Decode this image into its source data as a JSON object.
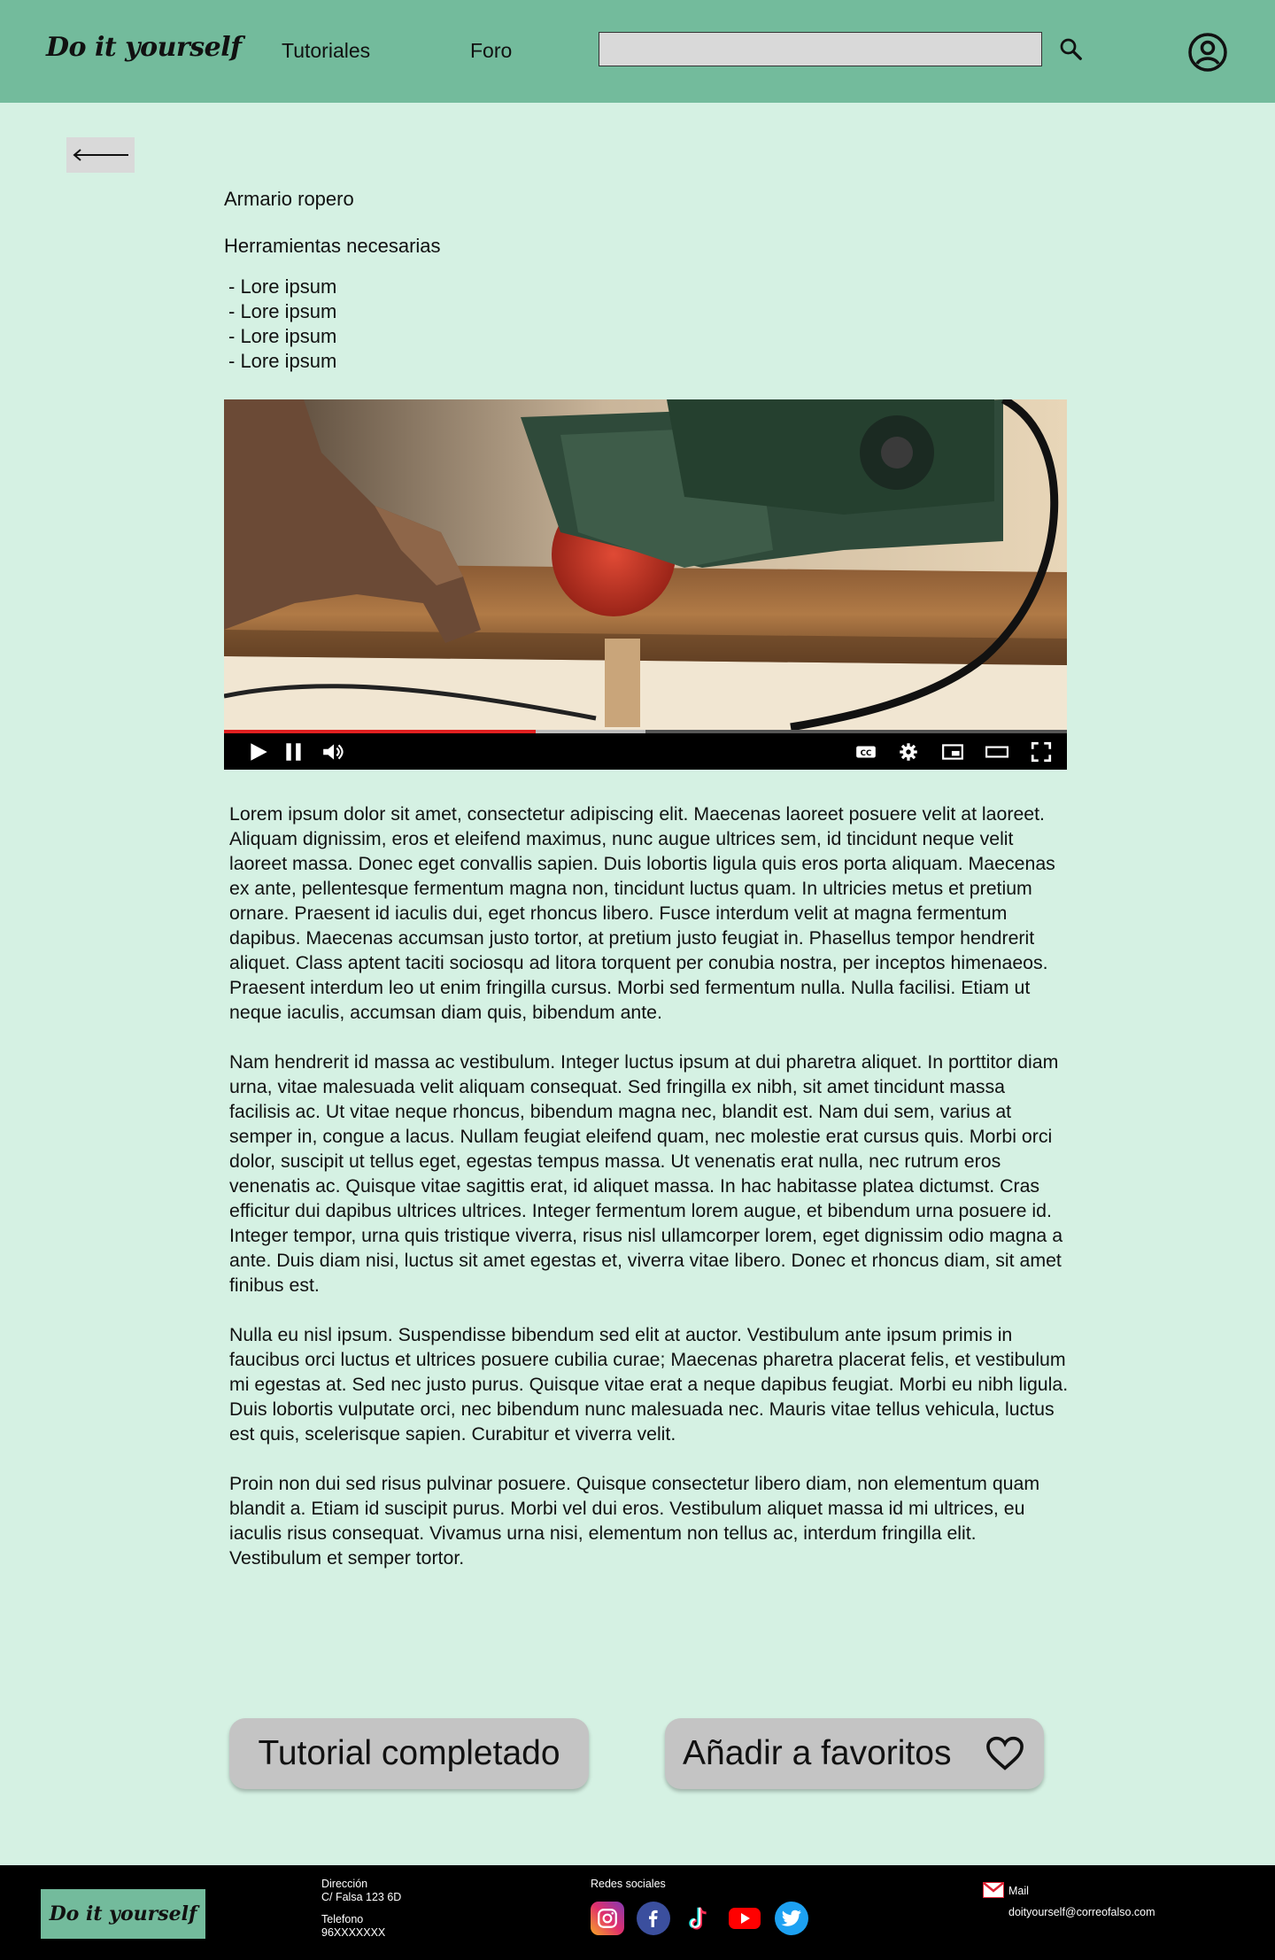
{
  "header": {
    "logo": "Do it yourself",
    "nav": [
      "Tutoriales",
      "Foro"
    ],
    "search": {
      "value": "",
      "placeholder": ""
    }
  },
  "tutorial": {
    "title": "Armario ropero",
    "tools_heading": "Herramientas necesarias",
    "tools": [
      "- Lore ipsum",
      "- Lore ipsum",
      "- Lore ipsum",
      "- Lore ipsum"
    ],
    "video_progress": 0.37,
    "video_buffered": 0.5
  },
  "article": {
    "paragraphs": [
      "Lorem ipsum dolor sit amet, consectetur adipiscing elit. Maecenas laoreet posuere velit at laoreet. Aliquam dignissim, eros et eleifend maximus, nunc augue ultrices sem, id tincidunt neque velit laoreet massa. Donec eget convallis sapien. Duis lobortis ligula quis eros porta aliquam. Maecenas ex ante, pellentesque fermentum magna non, tincidunt luctus quam. In ultricies metus et pretium ornare. Praesent id iaculis dui, eget rhoncus libero. Fusce interdum velit at magna fermentum dapibus. Maecenas accumsan justo tortor, at pretium justo feugiat in. Phasellus tempor hendrerit aliquet. Class aptent taciti sociosqu ad litora torquent per conubia nostra, per inceptos himenaeos. Praesent interdum leo ut enim fringilla cursus. Morbi sed fermentum nulla. Nulla facilisi. Etiam ut neque iaculis, accumsan diam quis, bibendum ante.",
      "Nam hendrerit id massa ac vestibulum. Integer luctus ipsum at dui pharetra aliquet. In porttitor diam urna, vitae malesuada velit aliquam consequat. Sed fringilla ex nibh, sit amet tincidunt massa facilisis ac. Ut vitae neque rhoncus, bibendum magna nec, blandit est. Nam dui sem, varius at semper in, congue a lacus. Nullam feugiat eleifend quam, nec molestie erat cursus quis. Morbi orci dolor, suscipit ut tellus eget, egestas tempus massa. Ut venenatis erat nulla, nec rutrum eros venenatis ac. Quisque vitae sagittis erat, id aliquet massa. In hac habitasse platea dictumst. Cras efficitur dui dapibus ultrices ultrices. Integer fermentum lorem augue, et bibendum urna posuere id. Integer tempor, urna quis tristique viverra, risus nisl ullamcorper lorem, eget dignissim odio magna a ante. Duis diam nisi, luctus sit amet egestas et, viverra vitae libero. Donec et rhoncus diam, sit amet finibus est.",
      "Nulla eu nisl ipsum. Suspendisse bibendum sed elit at auctor. Vestibulum ante ipsum primis in faucibus orci luctus et ultrices posuere cubilia curae; Maecenas pharetra placerat felis, et vestibulum mi egestas at. Sed nec justo purus. Quisque vitae erat a neque dapibus feugiat. Morbi eu nibh ligula. Duis lobortis vulputate orci, nec bibendum nunc malesuada nec. Mauris vitae tellus vehicula, luctus est quis, scelerisque sapien. Curabitur et viverra velit.",
      "Proin non dui sed risus pulvinar posuere. Quisque consectetur libero diam, non elementum quam blandit a. Etiam id suscipit purus. Morbi vel dui eros. Vestibulum aliquet massa id mi ultrices, eu iaculis risus consequat. Vivamus urna nisi, elementum non tellus ac, interdum fringilla elit. Vestibulum et semper tortor."
    ]
  },
  "actions": {
    "complete_label": "Tutorial completado",
    "favorite_label": "Añadir a favoritos"
  },
  "footer": {
    "logo": "Do it yourself",
    "address_label": "Dirección",
    "address_value": "C/ Falsa 123 6D",
    "phone_label": "Telefono",
    "phone_value": "96XXXXXXX",
    "social_label": "Redes sociales",
    "social": [
      "instagram-icon",
      "facebook-icon",
      "tiktok-icon",
      "youtube-icon",
      "twitter-icon"
    ],
    "mail_label": "Mail",
    "mail_value": "doityourself@correofalso.com"
  },
  "colors": {
    "header": "#73bb9c",
    "background": "#d5f1e3",
    "button": "#c4c4c4",
    "footer": "#000000"
  }
}
